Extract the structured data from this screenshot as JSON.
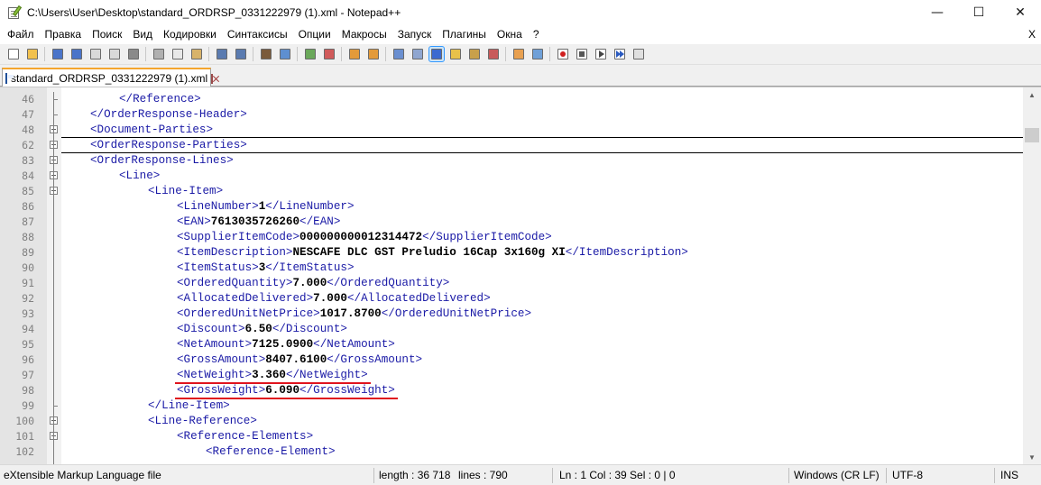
{
  "window": {
    "title": "C:\\Users\\User\\Desktop\\standard_ORDRSP_0331222979 (1).xml - Notepad++",
    "minimize": "—",
    "maximize": "☐",
    "close": "✕"
  },
  "menu": {
    "items": [
      "Файл",
      "Правка",
      "Поиск",
      "Вид",
      "Кодировки",
      "Синтаксисы",
      "Опции",
      "Макросы",
      "Запуск",
      "Плагины",
      "Окна",
      "?"
    ],
    "close_doc": "X"
  },
  "toolbar": {
    "icons": [
      "new-file-icon",
      "open-file-icon",
      "save-icon",
      "save-all-icon",
      "close-icon",
      "close-all-icon",
      "print-icon",
      "cut-icon",
      "copy-icon",
      "paste-icon",
      "undo-icon",
      "redo-icon",
      "find-icon",
      "replace-icon",
      "zoom-in-icon",
      "zoom-out-icon",
      "sync-v-icon",
      "sync-h-icon",
      "word-wrap-icon",
      "show-all-chars-icon",
      "indent-guide-icon",
      "udl-icon",
      "doc-map-icon",
      "function-list-icon",
      "folder-workspace-icon",
      "monitoring-icon",
      "record-macro-icon",
      "stop-record-icon",
      "play-macro-icon",
      "run-macro-multiple-icon",
      "save-macro-icon"
    ]
  },
  "tab": {
    "label": "standard_ORDRSP_0331222979 (1).xml"
  },
  "editor": {
    "lines": [
      {
        "n": "46",
        "indent": 2,
        "parts": [
          [
            "t",
            "</Reference>"
          ]
        ]
      },
      {
        "n": "47",
        "indent": 1,
        "parts": [
          [
            "t",
            "</OrderResponse-Header>"
          ]
        ]
      },
      {
        "n": "48",
        "indent": 1,
        "parts": [
          [
            "t",
            "<Document-Parties>"
          ]
        ]
      },
      {
        "n": "62",
        "indent": 1,
        "parts": [
          [
            "t",
            "<OrderResponse-Parties>"
          ]
        ]
      },
      {
        "n": "83",
        "indent": 1,
        "parts": [
          [
            "t",
            "<OrderResponse-Lines>"
          ]
        ]
      },
      {
        "n": "84",
        "indent": 2,
        "parts": [
          [
            "t",
            "<Line>"
          ]
        ]
      },
      {
        "n": "85",
        "indent": 3,
        "parts": [
          [
            "t",
            "<Line-Item>"
          ]
        ]
      },
      {
        "n": "86",
        "indent": 4,
        "parts": [
          [
            "t",
            "<LineNumber>"
          ],
          [
            "v",
            "1"
          ],
          [
            "t",
            "</LineNumber>"
          ]
        ]
      },
      {
        "n": "87",
        "indent": 4,
        "parts": [
          [
            "t",
            "<EAN>"
          ],
          [
            "v",
            "7613035726260"
          ],
          [
            "t",
            "</EAN>"
          ]
        ]
      },
      {
        "n": "88",
        "indent": 4,
        "parts": [
          [
            "t",
            "<SupplierItemCode>"
          ],
          [
            "v",
            "000000000012314472"
          ],
          [
            "t",
            "</SupplierItemCode>"
          ]
        ]
      },
      {
        "n": "89",
        "indent": 4,
        "parts": [
          [
            "t",
            "<ItemDescription>"
          ],
          [
            "v",
            "NESCAFE DLC GST Preludio 16Cap 3x160g XI"
          ],
          [
            "t",
            "</ItemDescription>"
          ]
        ]
      },
      {
        "n": "90",
        "indent": 4,
        "parts": [
          [
            "t",
            "<ItemStatus>"
          ],
          [
            "v",
            "3"
          ],
          [
            "t",
            "</ItemStatus>"
          ]
        ]
      },
      {
        "n": "91",
        "indent": 4,
        "parts": [
          [
            "t",
            "<OrderedQuantity>"
          ],
          [
            "v",
            "7.000"
          ],
          [
            "t",
            "</OrderedQuantity>"
          ]
        ]
      },
      {
        "n": "92",
        "indent": 4,
        "parts": [
          [
            "t",
            "<AllocatedDelivered>"
          ],
          [
            "v",
            "7.000"
          ],
          [
            "t",
            "</AllocatedDelivered>"
          ]
        ]
      },
      {
        "n": "93",
        "indent": 4,
        "parts": [
          [
            "t",
            "<OrderedUnitNetPrice>"
          ],
          [
            "v",
            "1017.8700"
          ],
          [
            "t",
            "</OrderedUnitNetPrice>"
          ]
        ]
      },
      {
        "n": "94",
        "indent": 4,
        "parts": [
          [
            "t",
            "<Discount>"
          ],
          [
            "v",
            "6.50"
          ],
          [
            "t",
            "</Discount>"
          ]
        ]
      },
      {
        "n": "95",
        "indent": 4,
        "parts": [
          [
            "t",
            "<NetAmount>"
          ],
          [
            "v",
            "7125.0900"
          ],
          [
            "t",
            "</NetAmount>"
          ]
        ]
      },
      {
        "n": "96",
        "indent": 4,
        "parts": [
          [
            "t",
            "<GrossAmount>"
          ],
          [
            "v",
            "8407.6100"
          ],
          [
            "t",
            "</GrossAmount>"
          ]
        ]
      },
      {
        "n": "97",
        "indent": 4,
        "parts": [
          [
            "t",
            "<NetWeight>"
          ],
          [
            "v",
            "3.360"
          ],
          [
            "t",
            "</NetWeight>"
          ]
        ]
      },
      {
        "n": "98",
        "indent": 4,
        "parts": [
          [
            "t",
            "<GrossWeight>"
          ],
          [
            "v",
            "6.090"
          ],
          [
            "t",
            "</GrossWeight>"
          ]
        ]
      },
      {
        "n": "99",
        "indent": 3,
        "parts": [
          [
            "t",
            "</Line-Item>"
          ]
        ]
      },
      {
        "n": "100",
        "indent": 3,
        "parts": [
          [
            "t",
            "<Line-Reference>"
          ]
        ]
      },
      {
        "n": "101",
        "indent": 4,
        "parts": [
          [
            "t",
            "<Reference-Elements>"
          ]
        ]
      },
      {
        "n": "102",
        "indent": 5,
        "parts": [
          [
            "t",
            "<Reference-Element>"
          ]
        ]
      }
    ]
  },
  "status": {
    "file_type": "eXtensible Markup Language file",
    "length": "length : 36 718",
    "lines": "lines : 790",
    "position": "Ln : 1    Col : 39    Sel : 0 | 0",
    "eol": "Windows (CR LF)",
    "encoding": "UTF-8",
    "mode": "INS"
  }
}
